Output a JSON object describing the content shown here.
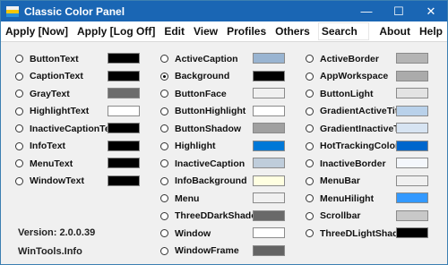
{
  "window": {
    "title": "Classic Color Panel"
  },
  "menu": [
    "Apply [Now]",
    "Apply [Log Off]",
    "Edit",
    "View",
    "Profiles",
    "Others",
    "Search",
    "About",
    "Help"
  ],
  "columns": [
    [
      {
        "label": "ButtonText",
        "color": "#000000"
      },
      {
        "label": "CaptionText",
        "color": "#000000"
      },
      {
        "label": "GrayText",
        "color": "#6d6d6d"
      },
      {
        "label": "HighlightText",
        "color": "#ffffff"
      },
      {
        "label": "InactiveCaptionTe",
        "color": "#000000"
      },
      {
        "label": "InfoText",
        "color": "#000000"
      },
      {
        "label": "MenuText",
        "color": "#000000"
      },
      {
        "label": "WindowText",
        "color": "#000000"
      }
    ],
    [
      {
        "label": "ActiveCaption",
        "color": "#99b4d1"
      },
      {
        "label": "Background",
        "color": "#000000",
        "selected": true
      },
      {
        "label": "ButtonFace",
        "color": "#f0f0f0"
      },
      {
        "label": "ButtonHighlight",
        "color": "#ffffff"
      },
      {
        "label": "ButtonShadow",
        "color": "#a0a0a0"
      },
      {
        "label": "Highlight",
        "color": "#0078d7"
      },
      {
        "label": "InactiveCaption",
        "color": "#bfcddb"
      },
      {
        "label": "InfoBackground",
        "color": "#ffffe1"
      },
      {
        "label": "Menu",
        "color": "#f0f0f0"
      },
      {
        "label": "ThreeDDarkShado",
        "color": "#696969"
      },
      {
        "label": "Window",
        "color": "#ffffff"
      },
      {
        "label": "WindowFrame",
        "color": "#646464"
      }
    ],
    [
      {
        "label": "ActiveBorder",
        "color": "#b4b4b4"
      },
      {
        "label": "AppWorkspace",
        "color": "#ababab"
      },
      {
        "label": "ButtonLight",
        "color": "#e3e3e3"
      },
      {
        "label": "GradientActiveTit",
        "color": "#b9d1ea"
      },
      {
        "label": "GradientInactiveT",
        "color": "#d7e4f2"
      },
      {
        "label": "HotTrackingColor",
        "color": "#0066cc"
      },
      {
        "label": "InactiveBorder",
        "color": "#f4f7fc"
      },
      {
        "label": "MenuBar",
        "color": "#f0f0f0"
      },
      {
        "label": "MenuHilight",
        "color": "#3399ff"
      },
      {
        "label": "Scrollbar",
        "color": "#c8c8c8"
      },
      {
        "label": "ThreeDLightShad",
        "color": "#000000"
      }
    ]
  ],
  "footer": {
    "version": "Version: 2.0.0.39",
    "site": "WinTools.Info"
  }
}
